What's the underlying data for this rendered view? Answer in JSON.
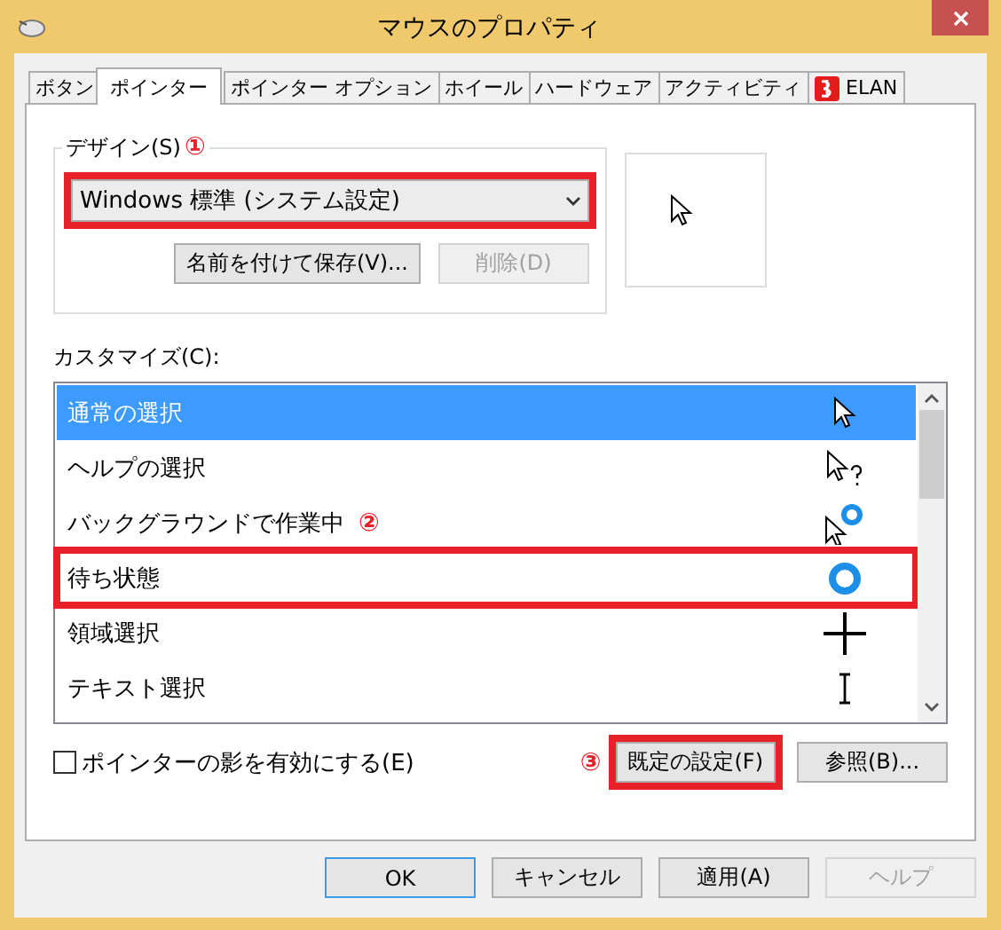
{
  "window": {
    "title": "マウスのプロパティ"
  },
  "tabs": [
    {
      "label": "ボタン",
      "selected": false
    },
    {
      "label": "ポインター",
      "selected": true
    },
    {
      "label": "ポインター オプション",
      "selected": false
    },
    {
      "label": "ホイール",
      "selected": false
    },
    {
      "label": "ハードウェア",
      "selected": false
    },
    {
      "label": "アクティビティ",
      "selected": false
    },
    {
      "label": "ELAN",
      "selected": false,
      "kind": "logo"
    }
  ],
  "design": {
    "label": "デザイン(S)",
    "marker": "①",
    "scheme": {
      "value": "Windows 標準 (システム設定)",
      "highlighted": true
    },
    "buttons": [
      {
        "label": "名前を付けて保存(V)...",
        "disabled": false
      },
      {
        "label": "削除(D)",
        "disabled": true
      }
    ]
  },
  "customize": {
    "label": "カスタマイズ(C):",
    "items": [
      {
        "label": "通常の選択",
        "kind": "arrow",
        "selected": true,
        "highlighted": false
      },
      {
        "label": "ヘルプの選択",
        "kind": "help",
        "selected": false,
        "highlighted": false
      },
      {
        "label": "バックグラウンドで作業中",
        "kind": "working",
        "selected": false,
        "highlighted": false,
        "marker": "②"
      },
      {
        "label": "待ち状態",
        "kind": "busy",
        "selected": false,
        "highlighted": true
      },
      {
        "label": "領域選択",
        "kind": "cross",
        "selected": false,
        "highlighted": false
      },
      {
        "label": "テキスト選択",
        "kind": "beam",
        "selected": false,
        "highlighted": false
      }
    ]
  },
  "shadow": {
    "label": "ポインターの影を有効にする(E)",
    "checked": false
  },
  "default_button": {
    "label": "既定の設定(F)",
    "marker": "③",
    "highlighted": true
  },
  "browse_button": {
    "label": "参照(B)..."
  },
  "buttons": [
    {
      "label": "OK",
      "disabled": false,
      "default": true
    },
    {
      "label": "キャンセル",
      "disabled": false,
      "default": false
    },
    {
      "label": "適用(A)",
      "disabled": false,
      "default": false
    },
    {
      "label": "ヘルプ",
      "disabled": true,
      "default": false
    }
  ]
}
